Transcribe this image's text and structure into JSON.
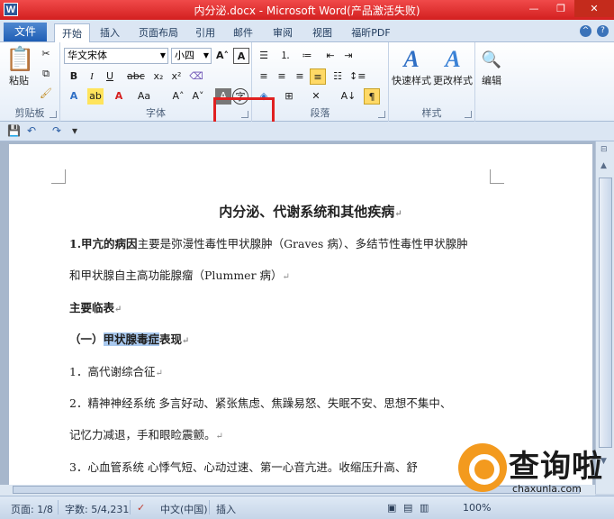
{
  "window": {
    "title": "内分泌.docx - Microsoft Word(产品激活失败)",
    "app_icon": "W"
  },
  "tabs": {
    "file": "文件",
    "items": [
      "开始",
      "插入",
      "页面布局",
      "引用",
      "邮件",
      "审阅",
      "视图",
      "福昕PDF"
    ],
    "active": "开始"
  },
  "ribbon": {
    "clipboard": {
      "label": "剪贴板",
      "paste": "粘贴"
    },
    "font": {
      "label": "字体",
      "font_name": "华文宋体",
      "font_size": "小四"
    },
    "paragraph": {
      "label": "段落"
    },
    "styles": {
      "label": "样式",
      "quick_styles": "快速样式",
      "change_styles": "更改样式"
    },
    "editing": {
      "label": "编辑"
    }
  },
  "document": {
    "title": "内分泌、代谢系统和其他疾病",
    "para1_bold": "1.甲亢的病因",
    "para1_rest": "主要是弥漫性毒性甲状腺肿（Graves 病）、多结节性毒性甲状腺肿",
    "para1_line2": "和甲状腺自主高功能腺瘤（Plummer 病）",
    "heading_main": "主要临表",
    "heading_sub_prefix": "（一）",
    "heading_sub_highlight": "甲状腺毒症",
    "heading_sub_suffix": "表现",
    "item1": "1．高代谢综合征",
    "item2": "2．精神神经系统  多言好动、紧张焦虑、焦躁易怒、失眠不安、思想不集中、",
    "item2_line2": "记忆力减退，手和眼睑震颤。",
    "item3": "3．心血管系统  心悸气短、心动过速、第一心音亢进。收缩压升高、舒",
    "para_mark": "↵"
  },
  "statusbar": {
    "page": "页面: 1/8",
    "words": "字数: 5/4,231",
    "language": "中文(中国)",
    "mode": "插入",
    "zoom": "100%"
  },
  "watermark": {
    "brand": "查询啦",
    "url": "chaxunla.com"
  },
  "colors": {
    "titlebar": "#e03030",
    "highlight": "#a8c8ee",
    "red_box": "#e02020"
  }
}
